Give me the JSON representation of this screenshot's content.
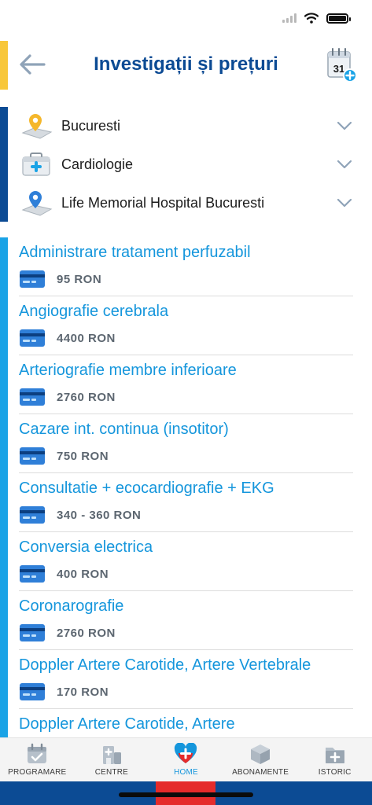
{
  "header": {
    "title": "Investigații și prețuri",
    "calendar_day": "31"
  },
  "filters": [
    {
      "label": "Bucuresti",
      "icon": "map-pin-icon"
    },
    {
      "label": "Cardiologie",
      "icon": "medical-kit-icon"
    },
    {
      "label": "Life Memorial Hospital Bucuresti",
      "icon": "location-pin-icon"
    }
  ],
  "items": [
    {
      "title": "Administrare tratament perfuzabil",
      "price": "95 RON"
    },
    {
      "title": "Angiografie cerebrala",
      "price": "4400 RON"
    },
    {
      "title": "Arteriografie membre inferioare",
      "price": "2760 RON"
    },
    {
      "title": "Cazare int. continua (insotitor)",
      "price": "750 RON"
    },
    {
      "title": "Consultatie + ecocardiografie + EKG",
      "price": "340 - 360 RON"
    },
    {
      "title": "Conversia electrica",
      "price": "400 RON"
    },
    {
      "title": "Coronarografie",
      "price": "2760 RON"
    },
    {
      "title": "Doppler Artere Carotide, Artere Vertebrale",
      "price": "170 RON"
    },
    {
      "title": "Doppler Artere Carotide, Artere",
      "price": ""
    }
  ],
  "tabs": [
    {
      "label": "PROGRAMARE",
      "icon": "calendar-check-icon",
      "active": false
    },
    {
      "label": "CENTRE",
      "icon": "hospital-building-icon",
      "active": false
    },
    {
      "label": "HOME",
      "icon": "heart-cross-icon",
      "active": true
    },
    {
      "label": "ABONAMENTE",
      "icon": "package-box-icon",
      "active": false
    },
    {
      "label": "ISTORIC",
      "icon": "medical-folder-icon",
      "active": false
    }
  ],
  "colors": {
    "title_blue": "#0c4b94",
    "link_blue": "#1596dc",
    "accent_yellow": "#f8c73a",
    "accent_dark_blue": "#0c4b94",
    "accent_light_blue": "#1aa3e6",
    "active_red": "#e52b2b"
  }
}
